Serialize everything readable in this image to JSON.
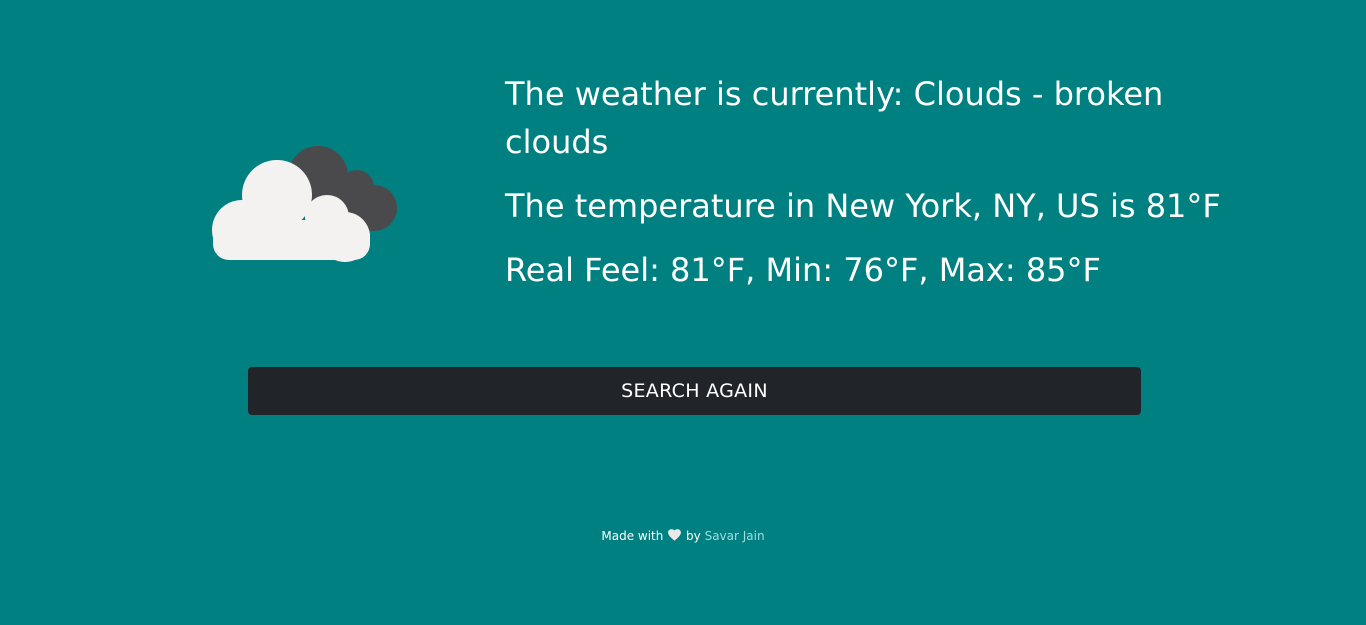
{
  "weather": {
    "icon": "clouds-icon",
    "description_line": "The weather is currently: Clouds - broken clouds",
    "temperature_line": "The temperature in New York, NY, US is 81°F",
    "details_line": "Real Feel: 81°F, Min: 76°F, Max: 85°F"
  },
  "actions": {
    "search_again_label": "SEARCH AGAIN"
  },
  "footer": {
    "prefix": "Made with",
    "heart_icon": "heart-icon",
    "by": "by",
    "author": "Savar Jain"
  },
  "colors": {
    "background": "#008080",
    "button": "#212529",
    "link": "#9fdde3"
  }
}
